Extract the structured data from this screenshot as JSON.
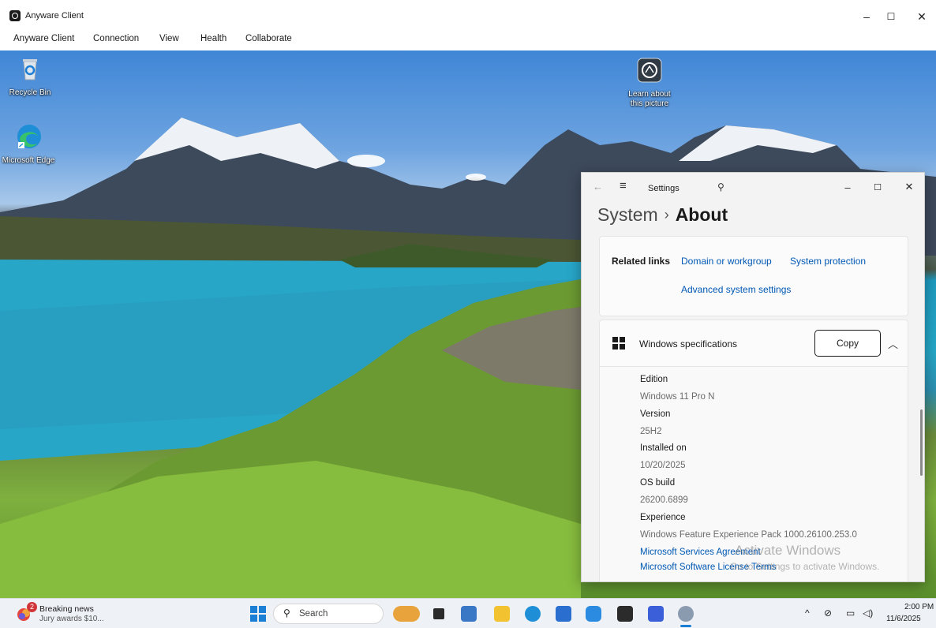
{
  "client": {
    "title": "Anyware Client",
    "menu": [
      "Anyware Client",
      "Connection",
      "View",
      "Health",
      "Collaborate"
    ],
    "controls": {
      "minimize": "–",
      "maximize": "☐",
      "close": "✕"
    }
  },
  "desktop": {
    "icons": [
      {
        "label": "Recycle Bin",
        "icon": "recycle-bin-icon"
      },
      {
        "label": "Microsoft Edge",
        "icon": "edge-icon"
      },
      {
        "label": "Learn about this picture",
        "icon": "camera-icon"
      }
    ]
  },
  "settings": {
    "app_name": "Settings",
    "breadcrumb_parent": "System",
    "breadcrumb_separator": "›",
    "breadcrumb_current": "About",
    "related_links": {
      "title": "Related links",
      "links": [
        "Domain or workgroup",
        "System protection",
        "Advanced system settings"
      ]
    },
    "windows_specs": {
      "title": "Windows specifications",
      "copy_label": "Copy",
      "fields": [
        {
          "key": "Edition",
          "value": "Windows 11 Pro N"
        },
        {
          "key": "Version",
          "value": "25H2"
        },
        {
          "key": "Installed on",
          "value": "10/20/2025"
        },
        {
          "key": "OS build",
          "value": "26200.6899"
        },
        {
          "key": "Experience",
          "value": "Windows Feature Experience Pack 1000.26100.253.0"
        }
      ],
      "links": [
        "Microsoft Services Agreement",
        "Microsoft Software License Terms"
      ]
    },
    "watermark": {
      "line1": "Activate Windows",
      "line2": "Go to Settings to activate Windows."
    }
  },
  "taskbar": {
    "news_title": "Breaking news",
    "news_subtitle": "Jury awards $10...",
    "news_badge": "2",
    "search_placeholder": "Search",
    "time": "2:00 PM",
    "date": "11/6/2025"
  },
  "colors": {
    "accent": "#0058b4",
    "windows_blue": "#1c7fd6",
    "badge": "#d13438"
  }
}
